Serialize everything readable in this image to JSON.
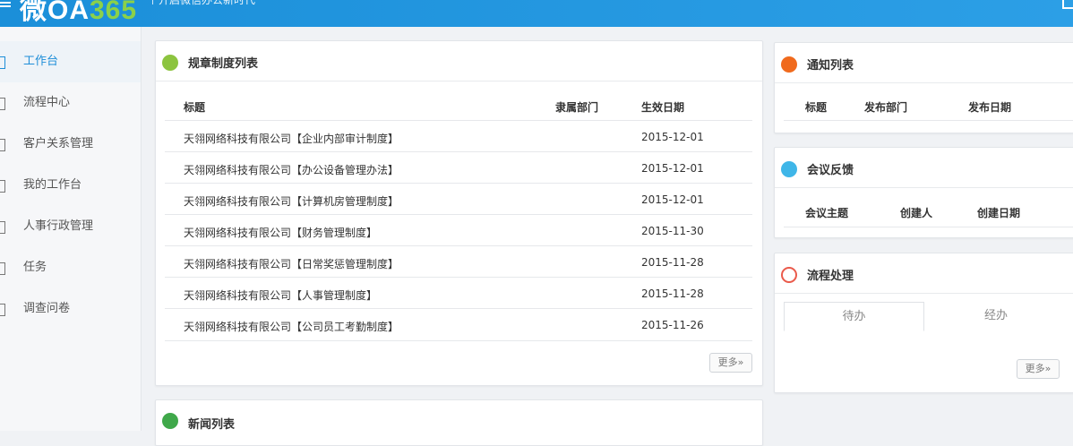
{
  "header": {
    "logo_main": "微OA",
    "logo_num": "365",
    "slogan": "开启微信办公新时代"
  },
  "sidebar": {
    "items": [
      {
        "label": "工作台",
        "icon": "dashboard-icon"
      },
      {
        "label": "流程中心",
        "icon": "list-icon"
      },
      {
        "label": "客户关系管理",
        "icon": "folder-icon"
      },
      {
        "label": "我的工作台",
        "icon": "folder-icon"
      },
      {
        "label": "人事行政管理",
        "icon": "folder-icon"
      },
      {
        "label": "任务",
        "icon": "task-icon"
      },
      {
        "label": "调查问卷",
        "icon": "survey-icon"
      }
    ]
  },
  "rules_panel": {
    "title": "规章制度列表",
    "columns": [
      "标题",
      "隶属部门",
      "生效日期"
    ],
    "rows": [
      {
        "title": "天翎网络科技有限公司【企业内部审计制度】",
        "dept": "",
        "date": "2015-12-01"
      },
      {
        "title": "天翎网络科技有限公司【办公设备管理办法】",
        "dept": "",
        "date": "2015-12-01"
      },
      {
        "title": "天翎网络科技有限公司【计算机房管理制度】",
        "dept": "",
        "date": "2015-12-01"
      },
      {
        "title": "天翎网络科技有限公司【财务管理制度】",
        "dept": "",
        "date": "2015-11-30"
      },
      {
        "title": "天翎网络科技有限公司【日常奖惩管理制度】",
        "dept": "",
        "date": "2015-11-28"
      },
      {
        "title": "天翎网络科技有限公司【人事管理制度】",
        "dept": "",
        "date": "2015-11-28"
      },
      {
        "title": "天翎网络科技有限公司【公司员工考勤制度】",
        "dept": "",
        "date": "2015-11-26"
      }
    ],
    "more": "更多»"
  },
  "news_panel": {
    "title": "新闻列表"
  },
  "notice_panel": {
    "title": "通知列表",
    "columns": [
      "标题",
      "发布部门",
      "发布日期"
    ]
  },
  "meeting_panel": {
    "title": "会议反馈",
    "columns": [
      "会议主题",
      "创建人",
      "创建日期"
    ]
  },
  "flow_panel": {
    "title": "流程处理",
    "tabs": [
      "待办",
      "经办"
    ],
    "more": "更多»"
  },
  "colors": {
    "header_blue": "#1b8fd9",
    "accent_green": "#8bd14a",
    "active_blue": "#1e8ed8",
    "notice_icon": "#f06a1d",
    "meeting_icon": "#3fb6e8",
    "flow_icon": "#ea5a4b"
  }
}
